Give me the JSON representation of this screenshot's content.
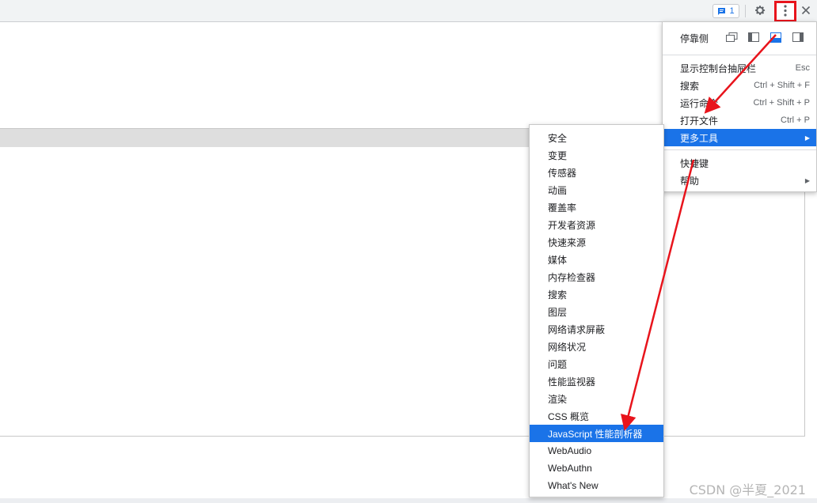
{
  "toolbar": {
    "issues_count": "1",
    "icons": [
      "issues-chat-icon",
      "gear-icon",
      "kebab-menu-icon",
      "close-icon"
    ]
  },
  "main_menu": {
    "dock_label": "停靠侧",
    "dock_icons": [
      "undock-icon",
      "dock-left-icon",
      "dock-bottom-icon",
      "dock-right-icon"
    ],
    "items": [
      {
        "label": "显示控制台抽屉栏",
        "shortcut": "Esc"
      },
      {
        "label": "搜索",
        "shortcut": "Ctrl + Shift + F"
      },
      {
        "label": "运行命令",
        "shortcut": "Ctrl + Shift + P"
      },
      {
        "label": "打开文件",
        "shortcut": "Ctrl + P"
      },
      {
        "label": "更多工具",
        "shortcut": "",
        "submenu": true,
        "active": true
      },
      {
        "label": "快捷键",
        "shortcut": ""
      },
      {
        "label": "帮助",
        "shortcut": "",
        "submenu": true
      }
    ]
  },
  "more_tools": {
    "items": [
      "安全",
      "变更",
      "传感器",
      "动画",
      "覆盖率",
      "开发者资源",
      "快速来源",
      "媒体",
      "内存检查器",
      "搜索",
      "图层",
      "网络请求屏蔽",
      "网络状况",
      "问题",
      "性能监视器",
      "渲染",
      "CSS 概览",
      "JavaScript 性能剖析器",
      "WebAudio",
      "WebAuthn",
      "What's New"
    ],
    "active_index": 17
  },
  "watermark": "CSDN @半夏_2021",
  "colors": {
    "accent": "#1a73e8",
    "annotation": "#e8141c"
  }
}
